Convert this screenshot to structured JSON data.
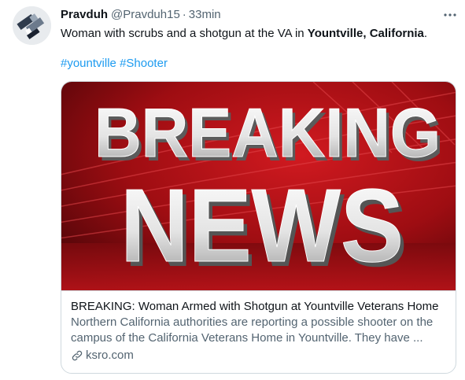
{
  "tweet": {
    "author": {
      "name": "Pravduh",
      "handle": "@Pravduh15",
      "separator": "·",
      "time": "33min",
      "avatar_icon": "geometric-logo-avatar"
    },
    "text_before": "Woman with scrubs and a shotgun at the VA in ",
    "text_bold": "Yountville, California",
    "text_after": ".",
    "hashtags": [
      "#yountville",
      "#Shooter"
    ],
    "more_icon": "ellipsis-icon"
  },
  "card": {
    "image_line1": "BREAKING",
    "image_line2": "NEWS",
    "title": "BREAKING: Woman Armed with Shotgun at Yountville Veterans Home",
    "description": "Northern California authorities are reporting a possible shooter on the campus of the California Veterans Home in Yountville. They have ...",
    "domain": "ksro.com",
    "domain_icon": "link-icon"
  },
  "colors": {
    "link": "#1d9bf0",
    "secondary_text": "#536471",
    "news_red": "#b01217"
  }
}
